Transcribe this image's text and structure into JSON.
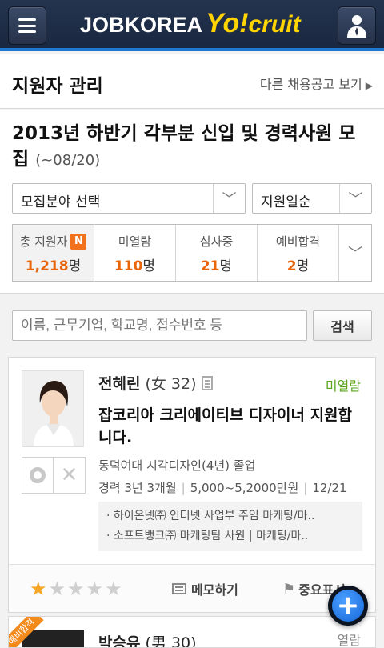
{
  "app": {
    "logo_main": "JOBKOREA",
    "logo_yo": "Yo!",
    "logo_cruit": "cruit"
  },
  "header": {
    "title": "지원자 관리",
    "other_link": "다른 채용공고 보기"
  },
  "job": {
    "title": "2013년 하반기 각부분 신입 및 경력사원 모집",
    "deadline": "(~08/20)"
  },
  "filters": {
    "field_select": "모집분야 선택",
    "sort_select": "지원일순"
  },
  "stats": [
    {
      "label": "총 지원자",
      "value": "1,218",
      "unit": "명",
      "badge": "N"
    },
    {
      "label": "미열람",
      "value": "110",
      "unit": "명"
    },
    {
      "label": "심사중",
      "value": "21",
      "unit": "명"
    },
    {
      "label": "예비합격",
      "value": "2",
      "unit": "명"
    }
  ],
  "search": {
    "placeholder": "이름, 근무기업, 학교명, 접수번호 등",
    "button": "검색"
  },
  "applicant": {
    "name": "전혜린",
    "meta": "(女 32)",
    "status": "미열람",
    "title": "잡코리아 크리에이티브 디자이너 지원합니다.",
    "education": "동덕여대 시각디자인(4년) 졸업",
    "career": "경력 3년 3개월",
    "salary": "5,000~5,2000만원",
    "date": "12/21",
    "history": [
      "· 하이온넷㈜ 인터넷 사업부 주임  마케팅/마..",
      "· 소프트뱅크㈜ 마케팅팀 사원 | 마케팅/마.."
    ],
    "rating": 1,
    "memo_label": "메모하기",
    "important_label": "중요표시"
  },
  "next_applicant": {
    "name": "박승유",
    "meta": "(男 30)",
    "status": "열람",
    "ribbon": "예비합격"
  },
  "colors": {
    "accent_orange": "#e9650a",
    "status_green": "#5aa51c",
    "topbar": "#1a2740",
    "fab_blue": "#1565d8"
  }
}
